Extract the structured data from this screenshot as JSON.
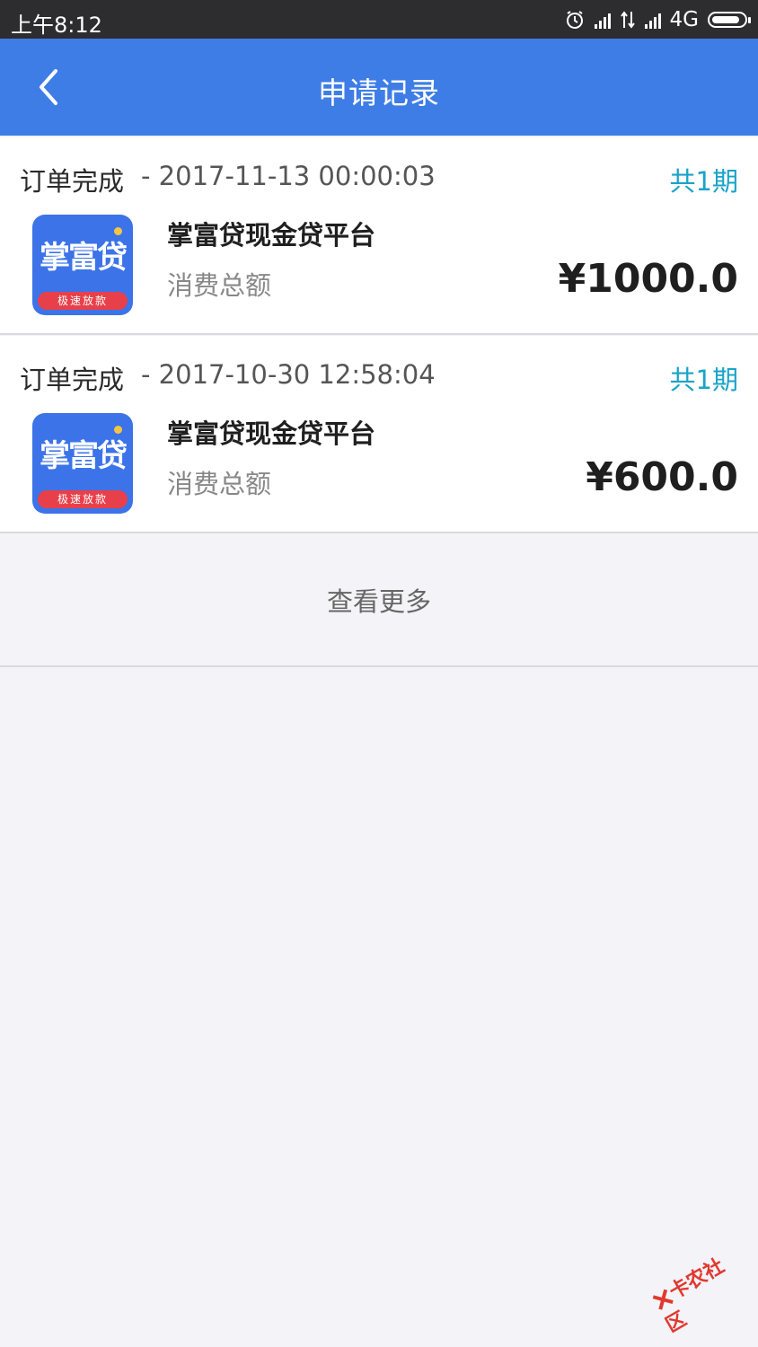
{
  "status_bar": {
    "time": "上午8:12",
    "network": "4G"
  },
  "app_bar": {
    "title": "申请记录"
  },
  "orders": [
    {
      "status": "订单完成",
      "date": "- 2017-11-13 00:00:03",
      "periods": "共1期",
      "platform": "掌富贷现金贷平台",
      "total_label": "消费总额",
      "amount": "¥1000.0",
      "logo_text": "掌富贷",
      "logo_ribbon": "极速放款"
    },
    {
      "status": "订单完成",
      "date": "- 2017-10-30 12:58:04",
      "periods": "共1期",
      "platform": "掌富贷现金贷平台",
      "total_label": "消费总额",
      "amount": "¥600.0",
      "logo_text": "掌富贷",
      "logo_ribbon": "极速放款"
    }
  ],
  "load_more": "查看更多",
  "watermark": "卡农社区",
  "colors": {
    "app_bar": "#3f7de6",
    "periods": "#1aa3c8",
    "status_bar": "#2d2d2f"
  }
}
